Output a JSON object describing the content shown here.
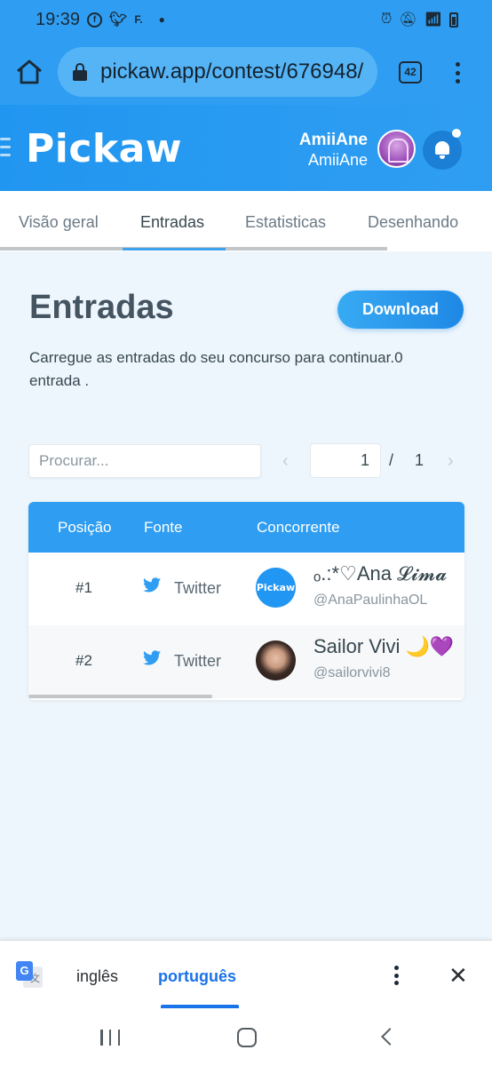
{
  "status_bar": {
    "time": "19:39",
    "left_icons": [
      "facebook-icon",
      "twitter-icon",
      "flipboard-icon",
      "dot-icon"
    ],
    "right_icons": [
      "alarm-icon",
      "mute-icon",
      "wifi-icon",
      "signal-icon",
      "battery-icon"
    ]
  },
  "browser": {
    "url": "pickaw.app/contest/676948/",
    "tab_count": "42"
  },
  "header": {
    "logo": "Pickaw",
    "user_name": "AmiiAne",
    "user_handle": "AmiiAne"
  },
  "tabs": [
    {
      "label": "Visão geral",
      "active": false
    },
    {
      "label": "Entradas",
      "active": true
    },
    {
      "label": "Estatisticas",
      "active": false
    },
    {
      "label": "Desenhando",
      "active": false
    }
  ],
  "main": {
    "title": "Entradas",
    "download_label": "Download",
    "subtitle": "Carregue as entradas do seu concurso para continuar.0 entrada ."
  },
  "search": {
    "placeholder": "Procurar..."
  },
  "pagination": {
    "current_page": "1",
    "separator": "/",
    "total_pages": "1"
  },
  "table": {
    "columns": [
      "Posição",
      "Fonte",
      "Concorrente"
    ],
    "rows": [
      {
        "position": "#1",
        "source": "Twitter",
        "name": "ₒ.:*♡Ana 𝓛𝓲𝓶𝓪",
        "handle": "@AnaPaulinhaOL",
        "avatar_text": "Pickaw"
      },
      {
        "position": "#2",
        "source": "Twitter",
        "name": "Sailor Vivi 🌙💜",
        "handle": "@sailorvivi8",
        "avatar_text": ""
      }
    ]
  },
  "translate_bar": {
    "lang_from": "inglês",
    "lang_to": "português"
  },
  "colors": {
    "brand_blue": "#2f9ef2",
    "translate_blue": "#1a73e8"
  }
}
